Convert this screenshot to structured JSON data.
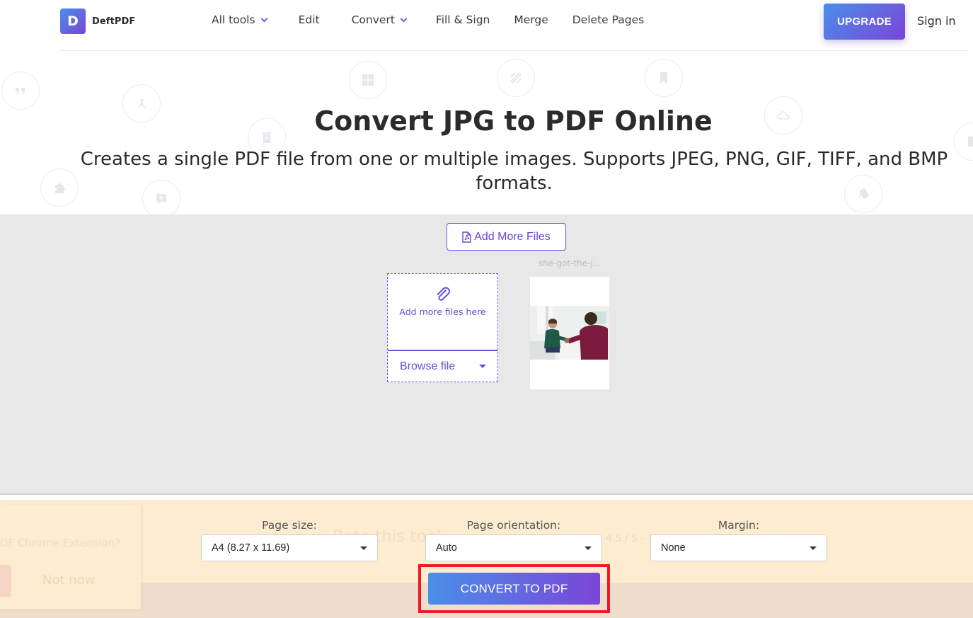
{
  "header": {
    "logo_letter": "D",
    "brand": "DeftPDF",
    "nav": [
      {
        "label": "All tools",
        "has_dropdown": true
      },
      {
        "label": "Edit",
        "has_dropdown": false
      },
      {
        "label": "Convert",
        "has_dropdown": true
      },
      {
        "label": "Fill & Sign",
        "has_dropdown": false
      },
      {
        "label": "Merge",
        "has_dropdown": false
      },
      {
        "label": "Delete Pages",
        "has_dropdown": false
      }
    ],
    "upgrade_label": "UPGRADE",
    "signin_label": "Sign in"
  },
  "hero": {
    "title": "Convert JPG to PDF Online",
    "subtitle": "Creates a single PDF file from one or multiple images. Supports JPEG, PNG, GIF, TIFF, and BMP formats.",
    "decorative_icons": [
      "quote-icon",
      "merge-icon",
      "delete-icon",
      "grid-icon",
      "stripes-icon",
      "bookmark-icon",
      "cloud-icon",
      "puzzle-icon",
      "add-comment-icon",
      "cards-icon",
      "add-page-icon"
    ]
  },
  "workspace": {
    "add_more_files_label": "Add More Files",
    "dropzone_text": "Add more files here",
    "browse_label": "Browse file",
    "files": [
      {
        "name": "she-got-the-j..."
      }
    ]
  },
  "options": {
    "page_size": {
      "label": "Page size:",
      "value": "A4 (8.27 x 11.69)"
    },
    "page_orientation": {
      "label": "Page orientation:",
      "value": "Auto"
    },
    "margin": {
      "label": "Margin:",
      "value": "None"
    },
    "convert_label": "CONVERT TO PDF",
    "rating_ghost_text": "Rate this tool",
    "rating_score_ghost": "4.5 / 5 - 1"
  },
  "extension_popup": {
    "text": "DF Chrome Extension?",
    "dismiss_label": "Not now"
  },
  "colors": {
    "accent_start": "#4a8fe8",
    "accent_end": "#7b45d8",
    "accent_text": "#6a45d3",
    "highlight_frame": "#ee1b24",
    "options_bg": "#feecd1",
    "workspace_bg": "#e8e8e8"
  }
}
